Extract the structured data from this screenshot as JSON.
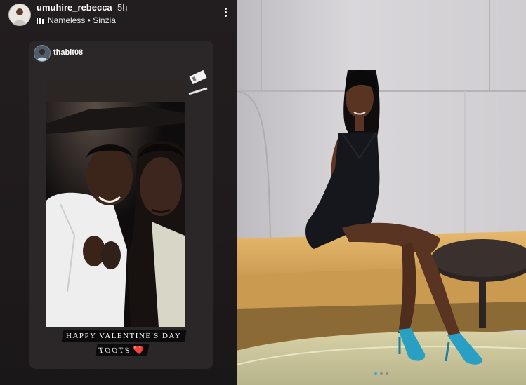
{
  "story": {
    "username": "umuhire_rebecca",
    "time": "5h",
    "music": "Nameless • Sinzia",
    "reshare_user": "thabit08",
    "caption_line1": "HAPPY VALENTINE'S DAY",
    "caption_line2": "TOOTS",
    "caption_emoji": "❤️"
  },
  "icons": {
    "menu": "more-vertical-icon",
    "music": "music-bars-icon",
    "sticker": "sticker-icon"
  },
  "colors": {
    "story_bg": "#221d1f",
    "card_bg": "#2b2628",
    "heart": "#e0403c",
    "sofa": "#d9a75e",
    "dress": "#15171c",
    "heels": "#2a9fc4",
    "wall": "#d4d2d5"
  }
}
